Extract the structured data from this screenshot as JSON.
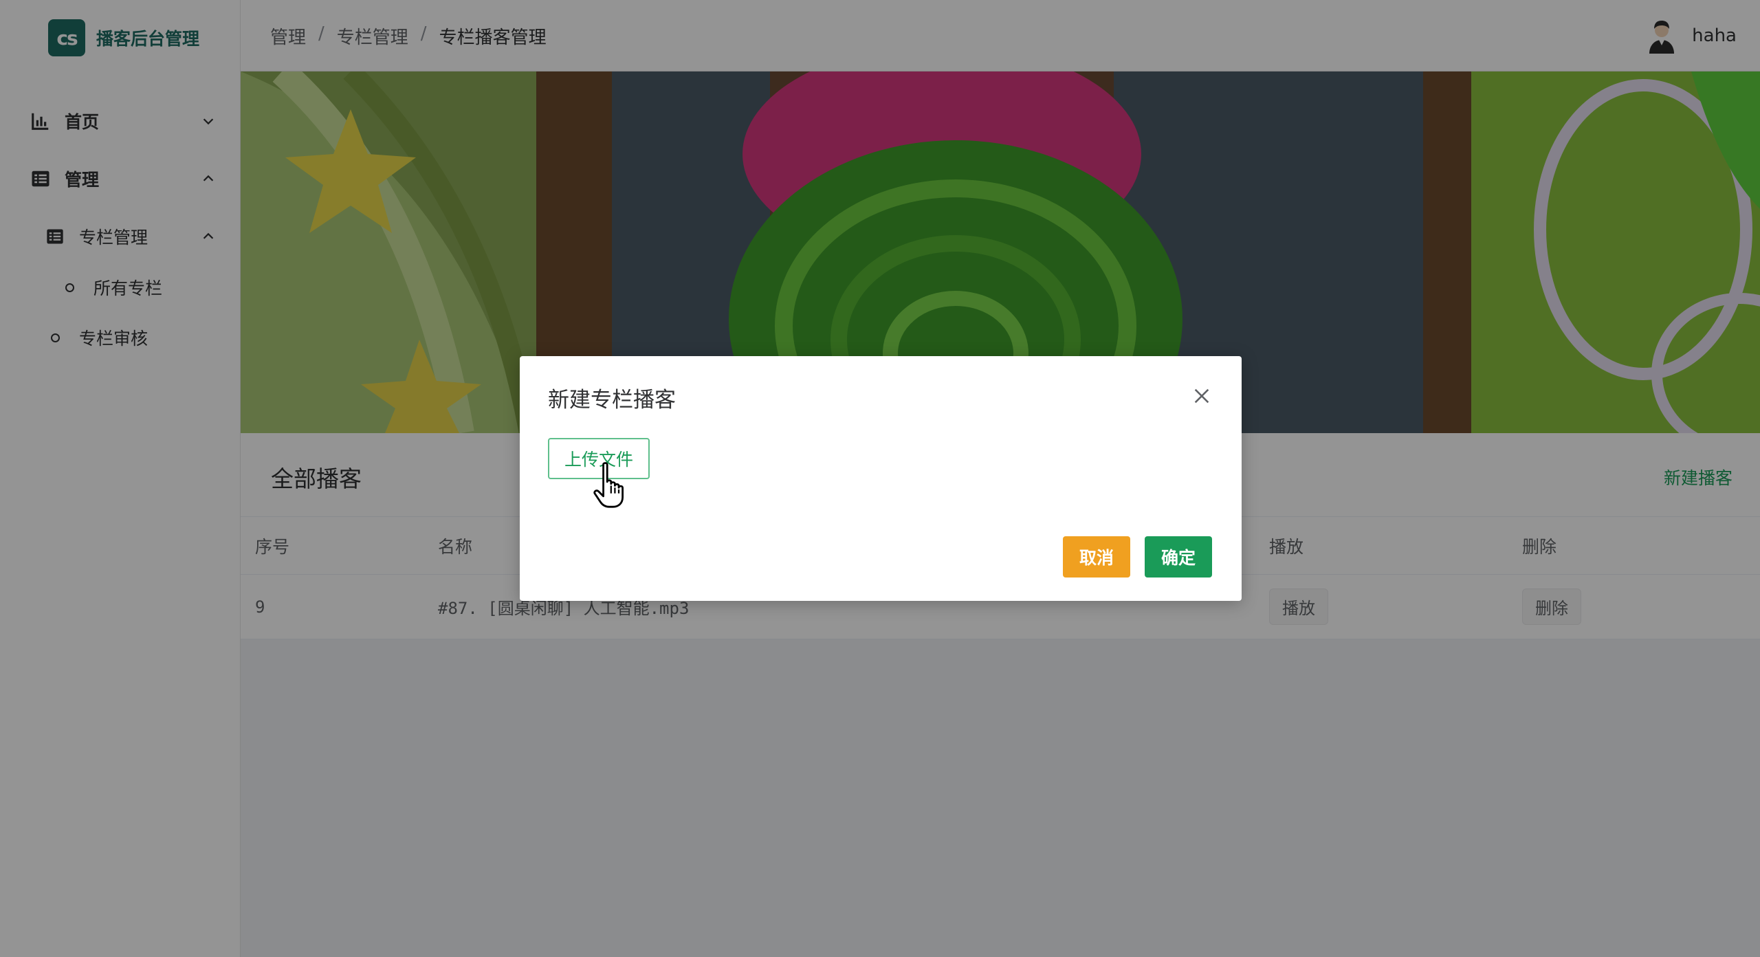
{
  "app": {
    "logo_mark": "cs",
    "title": "播客后台管理"
  },
  "sidebar": {
    "items": [
      {
        "label": "首页",
        "icon": "bar-chart-icon",
        "expanded": false
      },
      {
        "label": "管理",
        "icon": "list-icon",
        "expanded": true
      },
      {
        "label": "专栏管理",
        "icon": "list-icon",
        "expanded": true
      },
      {
        "label": "所有专栏",
        "icon": "circle-bullet-icon"
      },
      {
        "label": "专栏审核",
        "icon": "circle-bullet-icon"
      }
    ]
  },
  "header": {
    "breadcrumb": [
      "管理",
      "专栏管理",
      "专栏播客管理"
    ],
    "separator": "/",
    "username": "haha"
  },
  "content": {
    "card_title": "全部播客",
    "new_link": "新建播客",
    "table": {
      "columns": [
        "序号",
        "名称",
        "播放",
        "删除"
      ],
      "rows": [
        {
          "index": "9",
          "name": "#87. [圆桌闲聊] 人工智能.mp3",
          "play": "播放",
          "delete": "删除"
        }
      ]
    }
  },
  "dialog": {
    "title": "新建专栏播客",
    "upload_label": "上传文件",
    "cancel_label": "取消",
    "confirm_label": "确定"
  },
  "colors": {
    "brand": "#1e6b62",
    "primary": "#1a9b58",
    "warning": "#f0a020"
  }
}
